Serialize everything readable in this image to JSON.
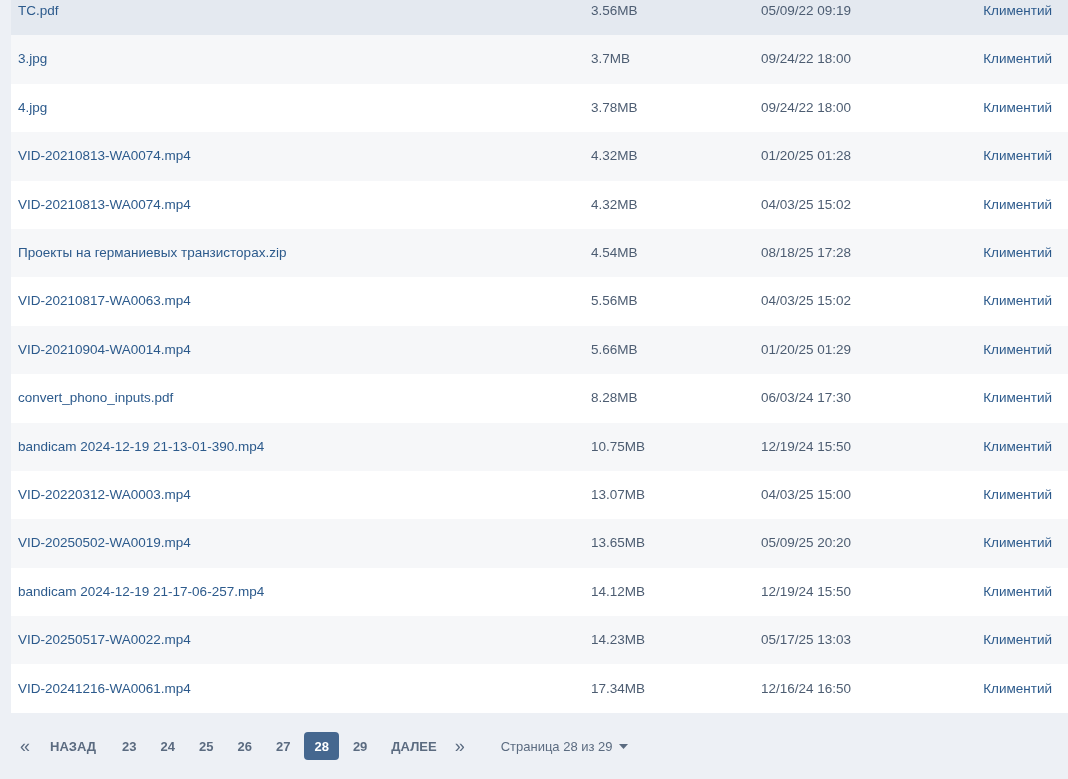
{
  "files": [
    {
      "name": "TC.pdf",
      "size": "3.56MB",
      "date": "05/09/22 09:19",
      "owner": "Климентий",
      "highlighted": true
    },
    {
      "name": "3.jpg",
      "size": "3.7MB",
      "date": "09/24/22 18:00",
      "owner": "Климентий",
      "highlighted": false
    },
    {
      "name": "4.jpg",
      "size": "3.78MB",
      "date": "09/24/22 18:00",
      "owner": "Климентий",
      "highlighted": false
    },
    {
      "name": "VID-20210813-WA0074.mp4",
      "size": "4.32MB",
      "date": "01/20/25 01:28",
      "owner": "Климентий",
      "highlighted": false
    },
    {
      "name": "VID-20210813-WA0074.mp4",
      "size": "4.32MB",
      "date": "04/03/25 15:02",
      "owner": "Климентий",
      "highlighted": false
    },
    {
      "name": "Проекты на германиевых транзисторах.zip",
      "size": "4.54MB",
      "date": "08/18/25 17:28",
      "owner": "Климентий",
      "highlighted": false
    },
    {
      "name": "VID-20210817-WA0063.mp4",
      "size": "5.56MB",
      "date": "04/03/25 15:02",
      "owner": "Климентий",
      "highlighted": false
    },
    {
      "name": "VID-20210904-WA0014.mp4",
      "size": "5.66MB",
      "date": "01/20/25 01:29",
      "owner": "Климентий",
      "highlighted": false
    },
    {
      "name": "convert_phono_inputs.pdf",
      "size": "8.28MB",
      "date": "06/03/24 17:30",
      "owner": "Климентий",
      "highlighted": false
    },
    {
      "name": "bandicam 2024-12-19 21-13-01-390.mp4",
      "size": "10.75MB",
      "date": "12/19/24 15:50",
      "owner": "Климентий",
      "highlighted": false
    },
    {
      "name": "VID-20220312-WA0003.mp4",
      "size": "13.07MB",
      "date": "04/03/25 15:00",
      "owner": "Климентий",
      "highlighted": false
    },
    {
      "name": "VID-20250502-WA0019.mp4",
      "size": "13.65MB",
      "date": "05/09/25 20:20",
      "owner": "Климентий",
      "highlighted": false
    },
    {
      "name": "bandicam 2024-12-19 21-17-06-257.mp4",
      "size": "14.12MB",
      "date": "12/19/24 15:50",
      "owner": "Климентий",
      "highlighted": false
    },
    {
      "name": "VID-20250517-WA0022.mp4",
      "size": "14.23MB",
      "date": "05/17/25 13:03",
      "owner": "Климентий",
      "highlighted": false
    },
    {
      "name": "VID-20241216-WA0061.mp4",
      "size": "17.34MB",
      "date": "12/16/24 16:50",
      "owner": "Климентий",
      "highlighted": false
    }
  ],
  "pagination": {
    "first": "«",
    "prev": "НАЗАД",
    "pages": [
      {
        "label": "23",
        "selected": false
      },
      {
        "label": "24",
        "selected": false
      },
      {
        "label": "25",
        "selected": false
      },
      {
        "label": "26",
        "selected": false
      },
      {
        "label": "27",
        "selected": false
      },
      {
        "label": "28",
        "selected": true
      },
      {
        "label": "29",
        "selected": false
      }
    ],
    "next": "ДАЛЕЕ",
    "last": "»",
    "page_info": "Страница 28 из 29"
  }
}
